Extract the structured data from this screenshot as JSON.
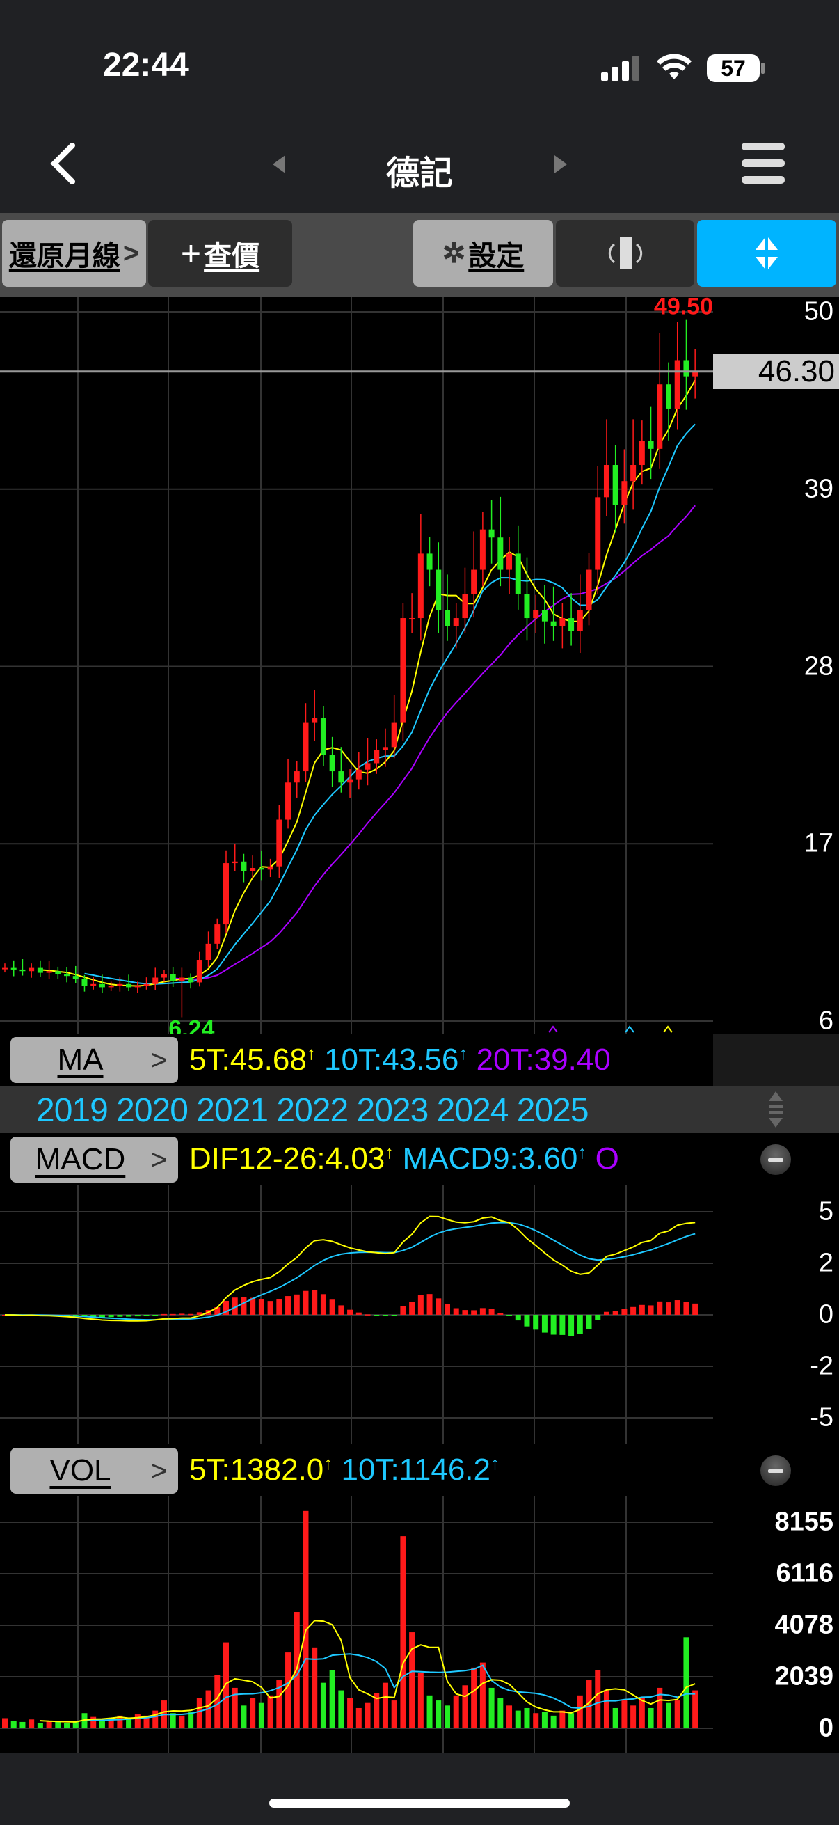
{
  "status": {
    "time": "22:44",
    "battery": "57"
  },
  "nav": {
    "title": "德記"
  },
  "toolbar": {
    "restore": "還原月線",
    "restore_chev": ">",
    "quote_plus": "+",
    "quote": "查價",
    "settings": "設定",
    "accent": "#00b4ff"
  },
  "price_axis": {
    "labels": [
      "50",
      "39",
      "28",
      "17",
      "6"
    ],
    "levels": [
      50,
      39,
      28,
      17,
      6
    ],
    "current": "46.30",
    "current_value": 46.3
  },
  "markers": {
    "high": "49.50",
    "high_value": 49.5,
    "high_index": 77,
    "low": "6.24",
    "low_value": 6.24,
    "low_index": 20
  },
  "ma_legend": {
    "name": "MA",
    "chev": ">",
    "ma5": "5T:45.68",
    "ma10": "10T:43.56",
    "ma20": "20T:39.40"
  },
  "years": [
    "2019",
    "2020",
    "2021",
    "2022",
    "2023",
    "2024",
    "2025"
  ],
  "macd_legend": {
    "name": "MACD",
    "chev": ">",
    "dif": "DIF12-26:4.03",
    "macd": "MACD9:3.60",
    "osc": "O"
  },
  "macd_axis": {
    "labels": [
      "5",
      "2",
      "0",
      "-2",
      "-5"
    ],
    "levels": [
      5,
      2.5,
      0,
      -2.5,
      -5
    ]
  },
  "vol_legend": {
    "name": "VOL",
    "chev": ">",
    "ma5": "5T:1382.0",
    "ma10": "10T:1146.2"
  },
  "vol_axis": {
    "labels": [
      "8155",
      "6116",
      "4078",
      "2039",
      "0"
    ],
    "levels": [
      8155,
      6116,
      4078,
      2039,
      0
    ]
  },
  "colors": {
    "up": "#ff1a1a",
    "down": "#22ee22",
    "ma5": "#ffff00",
    "ma10": "#1ec8ff",
    "ma20": "#aa00ff"
  },
  "chart_data": {
    "type": "candlestick",
    "period": "monthly",
    "close": [
      9.3,
      9.2,
      9.1,
      9.3,
      9.0,
      9.1,
      8.9,
      8.8,
      8.6,
      8.2,
      8.3,
      8.1,
      8.2,
      8.3,
      8.1,
      8.2,
      8.3,
      8.7,
      8.9,
      8.5,
      8.7,
      8.4,
      9.8,
      10.8,
      12.0,
      15.8,
      15.9,
      15.3,
      15.5,
      15.4,
      15.6,
      18.5,
      20.8,
      21.5,
      24.5,
      24.8,
      22.5,
      21.5,
      20.8,
      21.0,
      21.6,
      22.0,
      22.8,
      23.0,
      24.5,
      31.0,
      31.0,
      35.0,
      34.0,
      31.5,
      30.5,
      31.0,
      32.5,
      34.0,
      36.5,
      36.0,
      34.0,
      35.0,
      32.5,
      31.0,
      31.5,
      30.8,
      30.5,
      31.0,
      30.2,
      31.5,
      34.0,
      38.5,
      40.5,
      38.0,
      39.5,
      40.5,
      42.0,
      41.5,
      45.5,
      44.0,
      47.0,
      46.0,
      46.3
    ],
    "volume": [
      400,
      300,
      250,
      350,
      200,
      300,
      250,
      200,
      300,
      600,
      450,
      300,
      350,
      500,
      400,
      550,
      500,
      700,
      1100,
      600,
      500,
      650,
      1200,
      1500,
      2100,
      3400,
      1600,
      900,
      1200,
      1000,
      1300,
      1900,
      3000,
      4600,
      8600,
      3200,
      1800,
      2300,
      1500,
      1200,
      800,
      1000,
      1400,
      1800,
      1100,
      7600,
      3800,
      2200,
      1300,
      1100,
      900,
      1300,
      1700,
      2400,
      2600,
      1600,
      1200,
      900,
      700,
      800,
      600,
      650,
      500,
      700,
      600,
      1300,
      1900,
      2300,
      1500,
      800,
      1100,
      900,
      1200,
      800,
      1600,
      1000,
      1100,
      3600,
      1500
    ],
    "ma_periods": [
      5,
      10,
      20
    ],
    "ylim": [
      6,
      50
    ]
  }
}
